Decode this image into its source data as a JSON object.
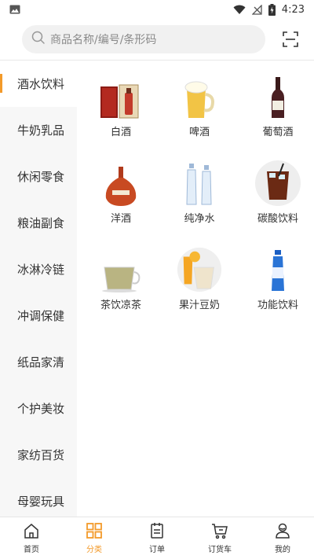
{
  "status_bar": {
    "time": "4:23",
    "icons": [
      "gallery-icon",
      "wifi-icon",
      "signal-icon",
      "battery-charging-icon"
    ]
  },
  "search": {
    "placeholder": "商品名称/编号/条形码",
    "icon": "search-icon",
    "scan_icon": "scan-icon"
  },
  "sidebar": {
    "items": [
      {
        "label": "酒水饮料",
        "active": true
      },
      {
        "label": "牛奶乳品"
      },
      {
        "label": "休闲零食"
      },
      {
        "label": "粮油副食"
      },
      {
        "label": "冰淋冷链"
      },
      {
        "label": "冲调保健"
      },
      {
        "label": "纸品家清"
      },
      {
        "label": "个护美妆"
      },
      {
        "label": "家纺百货"
      },
      {
        "label": "母婴玩具"
      }
    ]
  },
  "products": [
    {
      "label": "白酒",
      "icon": "baijiu-box-icon"
    },
    {
      "label": "啤酒",
      "icon": "beer-mug-icon"
    },
    {
      "label": "葡萄酒",
      "icon": "wine-bottle-icon"
    },
    {
      "label": "洋酒",
      "icon": "cognac-bottle-icon"
    },
    {
      "label": "纯净水",
      "icon": "water-bottles-icon"
    },
    {
      "label": "碳酸饮料",
      "icon": "soda-glass-icon"
    },
    {
      "label": "茶饮凉茶",
      "icon": "tea-glass-icon"
    },
    {
      "label": "果汁豆奶",
      "icon": "juice-milk-icon"
    },
    {
      "label": "功能饮料",
      "icon": "sports-drink-icon"
    }
  ],
  "tabbar": {
    "items": [
      {
        "label": "首页",
        "icon": "home-icon"
      },
      {
        "label": "分类",
        "icon": "category-icon",
        "active": true
      },
      {
        "label": "订单",
        "icon": "order-icon"
      },
      {
        "label": "订货车",
        "icon": "cart-icon"
      },
      {
        "label": "我的",
        "icon": "profile-icon"
      }
    ]
  },
  "colors": {
    "accent": "#f39a2a",
    "sidebar_bg": "#f7f7f7",
    "search_bg": "#f1f1f1"
  }
}
